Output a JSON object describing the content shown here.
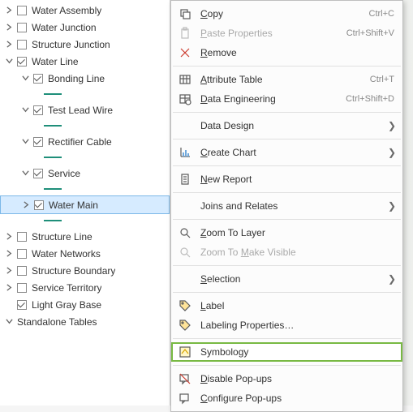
{
  "toc": {
    "layers": [
      {
        "label": "Water Assembly",
        "indent": 0,
        "expand": "right",
        "checked": false
      },
      {
        "label": "Water Junction",
        "indent": 0,
        "expand": "right",
        "checked": false
      },
      {
        "label": "Structure Junction",
        "indent": 0,
        "expand": "right",
        "checked": false
      },
      {
        "label": "Water Line",
        "indent": 0,
        "expand": "down",
        "checked": true
      },
      {
        "label": "Bonding Line",
        "indent": 1,
        "expand": "down",
        "checked": true,
        "swatch": true
      },
      {
        "label": "Test Lead Wire",
        "indent": 1,
        "expand": "down",
        "checked": true,
        "swatch": true
      },
      {
        "label": "Rectifier Cable",
        "indent": 1,
        "expand": "down",
        "checked": true,
        "swatch": true
      },
      {
        "label": "Service",
        "indent": 1,
        "expand": "down",
        "checked": true,
        "swatch": true
      },
      {
        "label": "Water Main",
        "indent": 1,
        "expand": "right",
        "checked": true,
        "swatch": true,
        "selected": true
      },
      {
        "label": "Structure Line",
        "indent": 0,
        "expand": "right",
        "checked": false
      },
      {
        "label": "Water Networks",
        "indent": 0,
        "expand": "right",
        "checked": false
      },
      {
        "label": "Structure Boundary",
        "indent": 0,
        "expand": "right",
        "checked": false
      },
      {
        "label": "Service Territory",
        "indent": 0,
        "expand": "right",
        "checked": false
      },
      {
        "label": "Light Gray Base",
        "indent": 0,
        "expand": "none",
        "checked": true
      }
    ],
    "heading": "Standalone Tables"
  },
  "contextMenu": {
    "items": [
      {
        "icon": "copy",
        "label": "Copy",
        "mn": "C",
        "shortcut": "Ctrl+C"
      },
      {
        "icon": "paste",
        "label": "Paste Properties",
        "mn": "P",
        "shortcut": "Ctrl+Shift+V",
        "disabled": true
      },
      {
        "icon": "remove",
        "label": "Remove",
        "mn": "R"
      },
      {
        "sep": true
      },
      {
        "icon": "table",
        "label": "Attribute Table",
        "mn": "A",
        "shortcut": "Ctrl+T"
      },
      {
        "icon": "dataeng",
        "label": "Data Engineering",
        "mn": "D",
        "shortcut": "Ctrl+Shift+D"
      },
      {
        "sep": true
      },
      {
        "icon": "none",
        "label": "Data Design",
        "submenu": true
      },
      {
        "sep": true
      },
      {
        "icon": "chart",
        "label": "Create Chart",
        "mn": "C",
        "submenu": true
      },
      {
        "sep": true
      },
      {
        "icon": "report",
        "label": "New Report",
        "mn": "N"
      },
      {
        "sep": true
      },
      {
        "icon": "none",
        "label": "Joins and Relates",
        "submenu": true
      },
      {
        "sep": true
      },
      {
        "icon": "zoomlayer",
        "label": "Zoom To Layer",
        "mn": "Z"
      },
      {
        "icon": "zoomvis",
        "label": "Zoom To Make Visible",
        "mn": "M",
        "disabled": true
      },
      {
        "sep": true
      },
      {
        "icon": "none",
        "label": "Selection",
        "mn": "S",
        "submenu": true
      },
      {
        "sep": true
      },
      {
        "icon": "label",
        "label": "Label",
        "mn": "L"
      },
      {
        "icon": "labelprop",
        "label": "Labeling Properties…"
      },
      {
        "sep": true
      },
      {
        "icon": "symbology",
        "label": "Symbology",
        "highlight": true
      },
      {
        "sep": true
      },
      {
        "icon": "popupoff",
        "label": "Disable Pop-ups",
        "mn": "D"
      },
      {
        "icon": "popupcfg",
        "label": "Configure Pop-ups",
        "mn": "C"
      }
    ]
  }
}
